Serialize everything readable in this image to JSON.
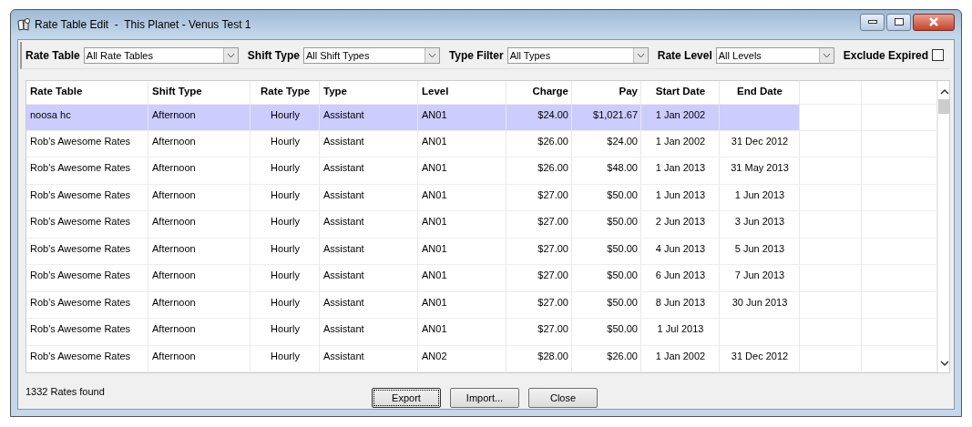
{
  "window": {
    "title": "Rate Table Edit  -  This Planet - Venus Test 1"
  },
  "filters": [
    {
      "label": "Rate Table",
      "value": "All Rate Tables"
    },
    {
      "label": "Shift Type",
      "value": "All Shift Types"
    },
    {
      "label": "Type Filter",
      "value": "All Types"
    },
    {
      "label": "Rate Level",
      "value": "All Levels"
    }
  ],
  "exclude_expired": {
    "label": "Exclude Expired",
    "checked": false
  },
  "table": {
    "columns": [
      "Rate Table",
      "Shift Type",
      "Rate Type",
      "Type",
      "Level",
      "Charge",
      "Pay",
      "Start Date",
      "End Date"
    ],
    "rows": [
      {
        "selected": true,
        "cells": [
          "noosa hc",
          "Afternoon",
          "Hourly",
          "Assistant",
          "AN01",
          "$24.00",
          "$1,021.67",
          "1 Jan 2002",
          ""
        ]
      },
      {
        "selected": false,
        "cells": [
          "Rob's Awesome Rates",
          "Afternoon",
          "Hourly",
          "Assistant",
          "AN01",
          "$26.00",
          "$24.00",
          "1 Jan 2002",
          "31 Dec 2012"
        ]
      },
      {
        "selected": false,
        "cells": [
          "Rob's Awesome Rates",
          "Afternoon",
          "Hourly",
          "Assistant",
          "AN01",
          "$26.00",
          "$48.00",
          "1 Jan 2013",
          "31 May 2013"
        ]
      },
      {
        "selected": false,
        "cells": [
          "Rob's Awesome Rates",
          "Afternoon",
          "Hourly",
          "Assistant",
          "AN01",
          "$27.00",
          "$50.00",
          "1 Jun 2013",
          "1 Jun 2013"
        ]
      },
      {
        "selected": false,
        "cells": [
          "Rob's Awesome Rates",
          "Afternoon",
          "Hourly",
          "Assistant",
          "AN01",
          "$27.00",
          "$50.00",
          "2 Jun 2013",
          "3 Jun 2013"
        ]
      },
      {
        "selected": false,
        "cells": [
          "Rob's Awesome Rates",
          "Afternoon",
          "Hourly",
          "Assistant",
          "AN01",
          "$27.00",
          "$50.00",
          "4 Jun 2013",
          "5 Jun 2013"
        ]
      },
      {
        "selected": false,
        "cells": [
          "Rob's Awesome Rates",
          "Afternoon",
          "Hourly",
          "Assistant",
          "AN01",
          "$27.00",
          "$50.00",
          "6 Jun 2013",
          "7 Jun 2013"
        ]
      },
      {
        "selected": false,
        "cells": [
          "Rob's Awesome Rates",
          "Afternoon",
          "Hourly",
          "Assistant",
          "AN01",
          "$27.00",
          "$50.00",
          "8 Jun 2013",
          "30 Jun 2013"
        ]
      },
      {
        "selected": false,
        "cells": [
          "Rob's Awesome Rates",
          "Afternoon",
          "Hourly",
          "Assistant",
          "AN01",
          "$27.00",
          "$50.00",
          "1 Jul 2013",
          ""
        ]
      },
      {
        "selected": false,
        "cells": [
          "Rob's Awesome Rates",
          "Afternoon",
          "Hourly",
          "Assistant",
          "AN02",
          "$28.00",
          "$26.00",
          "1 Jan 2002",
          "31 Dec 2012"
        ]
      }
    ]
  },
  "status": "1332 Rates found",
  "buttons": [
    {
      "label": "Export",
      "focused": true
    },
    {
      "label": "Import...",
      "focused": false
    },
    {
      "label": "Close",
      "focused": false
    }
  ]
}
